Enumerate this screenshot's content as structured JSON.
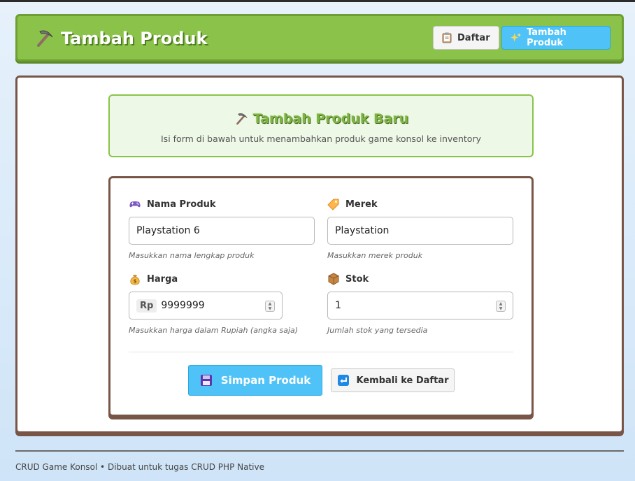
{
  "header": {
    "title": "Tambah Produk",
    "nav": {
      "daftar_label": "Daftar",
      "tambah_label": "Tambah Produk"
    }
  },
  "banner": {
    "title": "Tambah Produk Baru",
    "subtitle": "Isi form di bawah untuk menambahkan produk game konsol ke inventory"
  },
  "form": {
    "nama": {
      "label": "Nama Produk",
      "value": "Playstation 6",
      "help": "Masukkan nama lengkap produk",
      "icon": "gamepad-icon"
    },
    "merek": {
      "label": "Merek",
      "value": "Playstation",
      "help": "Masukkan merek produk",
      "icon": "tag-icon"
    },
    "harga": {
      "label": "Harga",
      "prefix": "Rp",
      "value": "9999999",
      "help": "Masukkan harga dalam Rupiah (angka saja)",
      "icon": "money-bag-icon"
    },
    "stok": {
      "label": "Stok",
      "value": "1",
      "help": "Jumlah stok yang tersedia",
      "icon": "package-icon"
    }
  },
  "actions": {
    "save_label": "Simpan Produk",
    "back_label": "Kembali ke Daftar"
  },
  "footer": {
    "text": "CRUD Game Konsol • Dibuat untuk tugas CRUD PHP Native"
  },
  "colors": {
    "header_green": "#8bc34a",
    "accent_blue": "#4fc3f7",
    "border_brown": "#795548"
  }
}
